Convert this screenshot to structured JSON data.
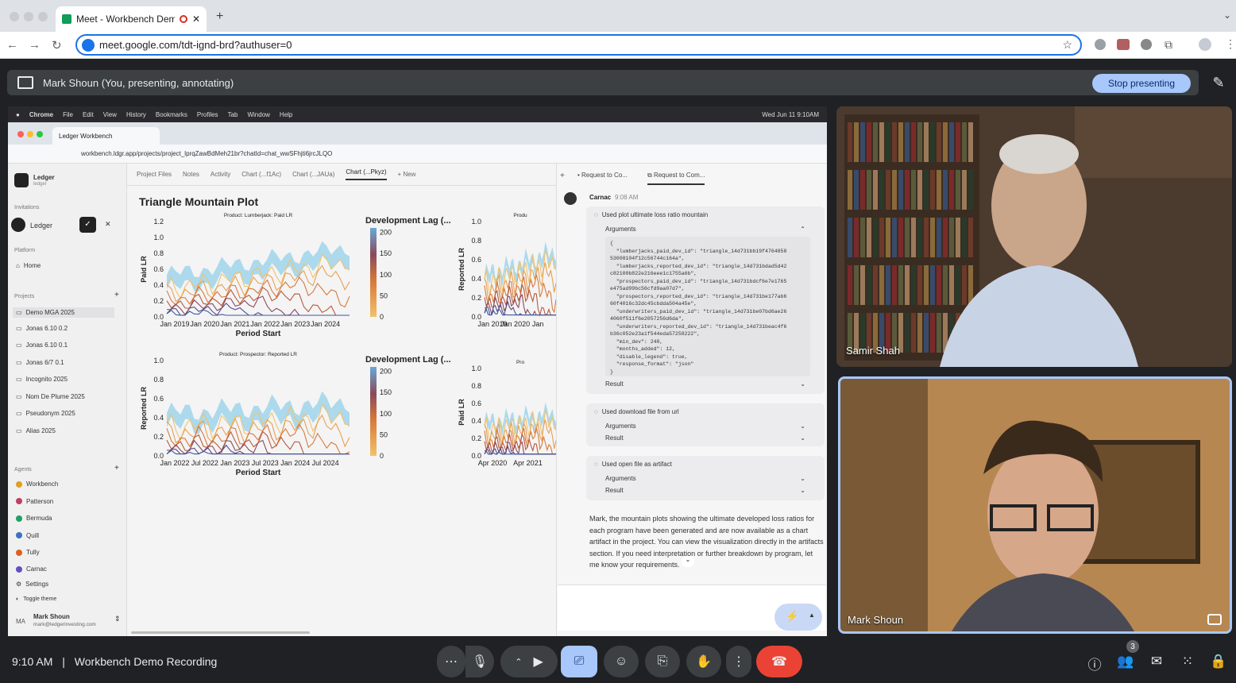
{
  "browser": {
    "tab_title": "Meet - Workbench Demo",
    "url": "meet.google.com/tdt-ignd-brd?authuser=0"
  },
  "present_bar": {
    "label": "Mark Shoun (You, presenting, annotating)",
    "stop_label": "Stop presenting"
  },
  "shared": {
    "mac_menu": [
      "Chrome",
      "File",
      "Edit",
      "View",
      "History",
      "Bookmarks",
      "Profiles",
      "Tab",
      "Window",
      "Help"
    ],
    "mac_clock": "Wed Jun 11  9:10AM",
    "inner_tab": "Ledger Workbench",
    "inner_url": "workbench.ldgr.app/projects/project_lprqZawBdMeh21br?chatId=chat_wwSFhjti6jrcJLQO",
    "sidebar": {
      "org_name": "Ledger",
      "org_sub": "ledger",
      "invitations_label": "Invitations",
      "invite_name": "Ledger",
      "platform_label": "Platform",
      "home": "Home",
      "projects_label": "Projects",
      "projects": [
        "Demo MGA 2025",
        "Jonas 6.10 0.2",
        "Jonas 6.10 0.1",
        "Jonas 6/7 0.1",
        "Incognito 2025",
        "Nom De Plume 2025",
        "Pseudonym 2025",
        "Alias 2025"
      ],
      "agents_label": "Agents",
      "agents": [
        "Workbench",
        "Patterson",
        "Bermuda",
        "Quill",
        "Tully",
        "Carnac"
      ],
      "settings": "Settings",
      "toggle_theme": "Toggle theme",
      "user_initials": "MA",
      "user_name": "Mark Shoun",
      "user_email": "mark@ledgerinvesting.com"
    },
    "content_tabs": [
      "Project Files",
      "Notes",
      "Activity",
      "Chart (...f1Ac)",
      "Chart (...JAUa)",
      "Chart (...Pkyz)",
      "New"
    ],
    "plot_title": "Triangle Mountain Plot",
    "chat": {
      "tabs": [
        "Request to Co...",
        "Request to Com..."
      ],
      "agent": "Carnac",
      "time": "9:08 AM",
      "tool1": "Used plot ultimate loss ratio mountain",
      "arguments": "Arguments",
      "result": "Result",
      "code": "{\n  \"lumberjacks_paid_dev_id\": \"triangle_14d731bb19f4764858\n53008104f12c56744c164a\",\n  \"lumberjacks_reported_dev_id\": \"triangle_14d731bdad5d42\nc82100b822e216eee1c1755a6b\",\n  \"prospectors_paid_dev_id\": \"triangle_14d731bdcf6e7e1765\ne475ad99bc56cfd9aa07d7\",\n  \"prospectors_reported_dev_id\": \"triangle_14d731be177ab6\n60f4016c32dc45cbdda504a45e\",\n  \"underwriters_paid_dev_id\": \"triangle_14d731be07bd6ae26\n4060f511f6e2057256d6da\",\n  \"underwriters_reported_dev_id\": \"triangle_14d731beac4f6\nb36c052e23a1f544eda57258222\",\n  \"min_dev\": 240,\n  \"months_added\": 12,\n  \"disable_legend\": true,\n  \"response_format\": \"json\"\n}",
      "tool2": "Used download file from url",
      "tool3": "Used open file as artifact",
      "message": "Mark, the mountain plots showing the ultimate developed loss ratios for each program have been generated and are now available as a chart artifact in the project. You can view the visualization directly in the artifacts section. If you need interpretation or further breakdown by program, let me know your requirements."
    }
  },
  "chart_data": [
    {
      "type": "area",
      "title": "Product: Lumberjack: Paid LR",
      "xlabel": "Period Start",
      "ylabel": "Paid LR",
      "x_ticks": [
        "Jan 2019",
        "Jan 2020",
        "Jan 2021",
        "Jan 2022",
        "Jan 2023",
        "Jan 2024"
      ],
      "y_ticks": [
        "0.0",
        "0.2",
        "0.4",
        "0.6",
        "0.8",
        "1.0",
        "1.2"
      ],
      "ylim": [
        0,
        1.2
      ],
      "colorbar": {
        "title": "Development Lag (...",
        "ticks": [
          "0",
          "50",
          "100",
          "150",
          "200"
        ]
      }
    },
    {
      "type": "area",
      "title": "Product: Prospector: Reported LR",
      "xlabel": "Period Start",
      "ylabel": "Reported LR",
      "x_ticks": [
        "Jan 2022",
        "Jul 2022",
        "Jan 2023",
        "Jul 2023",
        "Jan 2024",
        "Jul 2024"
      ],
      "y_ticks": [
        "0.0",
        "0.2",
        "0.4",
        "0.6",
        "0.8",
        "1.0"
      ],
      "ylim": [
        0,
        1.0
      ],
      "colorbar": {
        "title": "Development Lag (...",
        "ticks": [
          "0",
          "50",
          "100",
          "150",
          "200"
        ]
      }
    },
    {
      "type": "area",
      "title": "Produ",
      "ylabel": "Reported LR",
      "x_ticks": [
        "Jan 2019",
        "Jan 2020",
        "Jan"
      ],
      "y_ticks": [
        "0.0",
        "0.2",
        "0.4",
        "0.6",
        "0.8",
        "1.0"
      ]
    },
    {
      "type": "area",
      "title": "Pro",
      "ylabel": "Paid LR",
      "x_ticks": [
        "Apr 2020",
        "Apr 2021"
      ],
      "y_ticks": [
        "0.0",
        "0.2",
        "0.4",
        "0.6",
        "0.8",
        "1.0"
      ]
    }
  ],
  "meet": {
    "participant1": "Samir Shah",
    "participant2": "Mark Shoun",
    "time": "9:10 AM",
    "separator": "|",
    "meeting_name": "Workbench Demo Recording",
    "participant_count": "3"
  },
  "colors": {
    "accent": "#1a73e8",
    "stop_btn": "#a8c7fa",
    "end_call": "#ea4335"
  }
}
